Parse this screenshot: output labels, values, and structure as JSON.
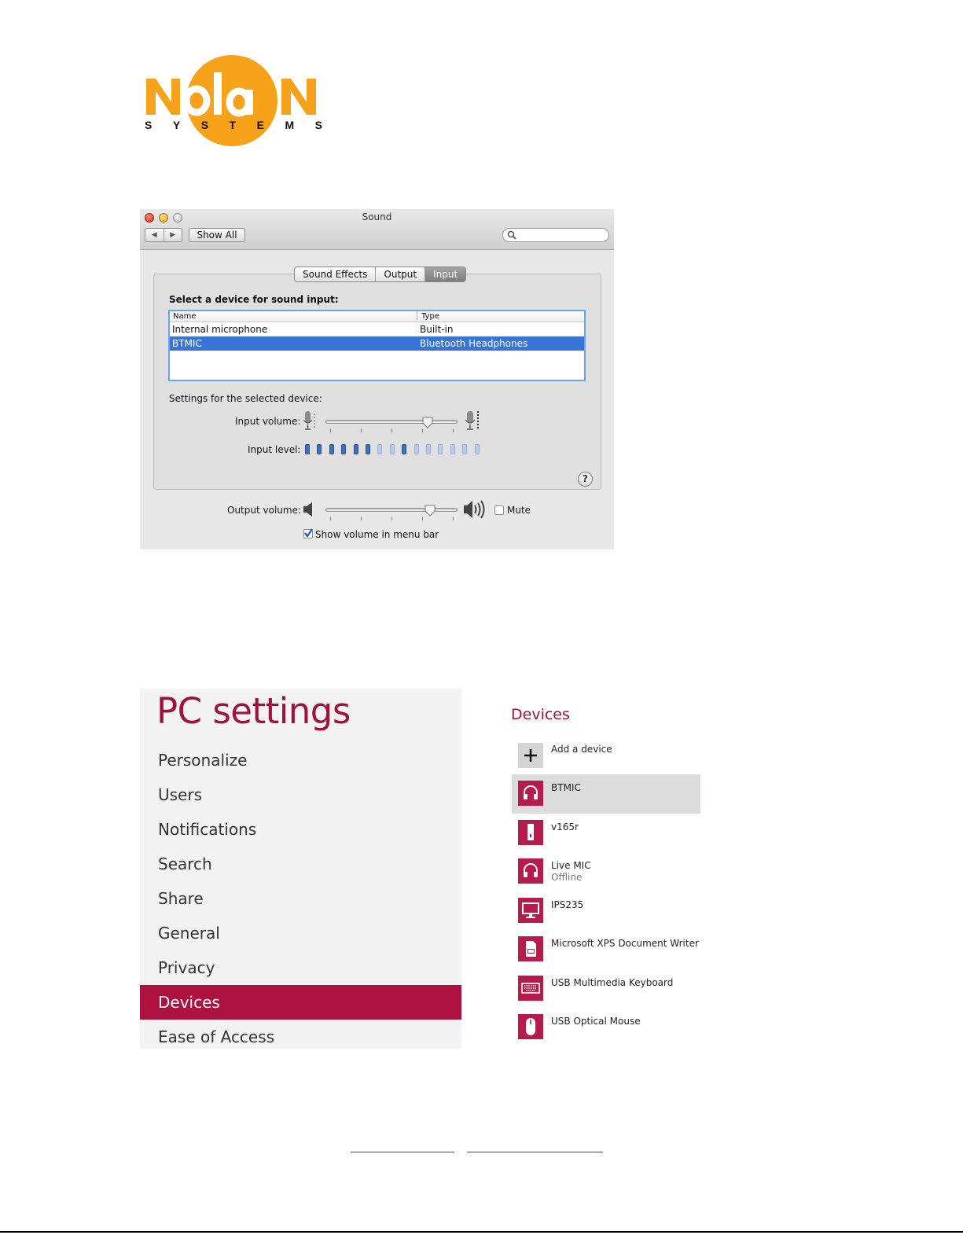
{
  "logo": {
    "wordmark": "NolaN",
    "subtitle_letters": [
      "S",
      "Y",
      "S",
      "T",
      "E",
      "M",
      "S"
    ],
    "colors": {
      "orange": "#f7a21b",
      "dark": "#111111"
    }
  },
  "sound_window": {
    "title": "Sound",
    "nav_back_glyph": "◀",
    "nav_forward_glyph": "▶",
    "show_all_label": "Show All",
    "search_placeholder": "",
    "tabs": [
      {
        "label": "Sound Effects",
        "active": false
      },
      {
        "label": "Output",
        "active": false
      },
      {
        "label": "Input",
        "active": true
      }
    ],
    "select_label": "Select a device for sound input:",
    "columns": {
      "name": "Name",
      "type": "Type"
    },
    "devices": [
      {
        "name": "Internal microphone",
        "type": "Built-in",
        "selected": false
      },
      {
        "name": "BTMIC",
        "type": "Bluetooth Headphones",
        "selected": true
      }
    ],
    "settings_label": "Settings for the selected device:",
    "input_volume_label": "Input volume:",
    "input_volume_level": 0.8,
    "input_level_label": "Input level:",
    "input_level_segments": 15,
    "input_level_active": [
      1,
      2,
      3,
      4,
      5,
      6,
      9
    ],
    "help_label": "?",
    "output_volume_label": "Output volume:",
    "output_volume_level": 0.82,
    "mute_label": "Mute",
    "mute_checked": false,
    "show_volume_label": "Show volume in menu bar",
    "show_volume_checked": true,
    "selection_color": "#3875d7"
  },
  "pc_settings": {
    "title": "PC settings",
    "accent_color": "#ad113f",
    "menu": [
      {
        "label": "Personalize",
        "active": false
      },
      {
        "label": "Users",
        "active": false
      },
      {
        "label": "Notifications",
        "active": false
      },
      {
        "label": "Search",
        "active": false
      },
      {
        "label": "Share",
        "active": false
      },
      {
        "label": "General",
        "active": false
      },
      {
        "label": "Privacy",
        "active": false
      },
      {
        "label": "Devices",
        "active": true
      },
      {
        "label": "Ease of Access",
        "active": false
      }
    ]
  },
  "devices_panel": {
    "header": "Devices",
    "items": [
      {
        "name": "Add a device",
        "icon": "plus-icon",
        "status": "",
        "active": false
      },
      {
        "name": "BTMIC",
        "icon": "headset-icon",
        "status": "",
        "active": true
      },
      {
        "name": "v165r",
        "icon": "usb-drive-icon",
        "status": "",
        "active": false
      },
      {
        "name": "Live MIC",
        "icon": "headset-icon",
        "status": "Offline",
        "active": false
      },
      {
        "name": "IPS235",
        "icon": "monitor-icon",
        "status": "",
        "active": false
      },
      {
        "name": "Microsoft XPS Document Writer",
        "icon": "printer-icon",
        "status": "",
        "active": false
      },
      {
        "name": "USB Multimedia Keyboard",
        "icon": "keyboard-icon",
        "status": "",
        "active": false
      },
      {
        "name": "USB Optical Mouse",
        "icon": "mouse-icon",
        "status": "",
        "active": false
      }
    ]
  }
}
